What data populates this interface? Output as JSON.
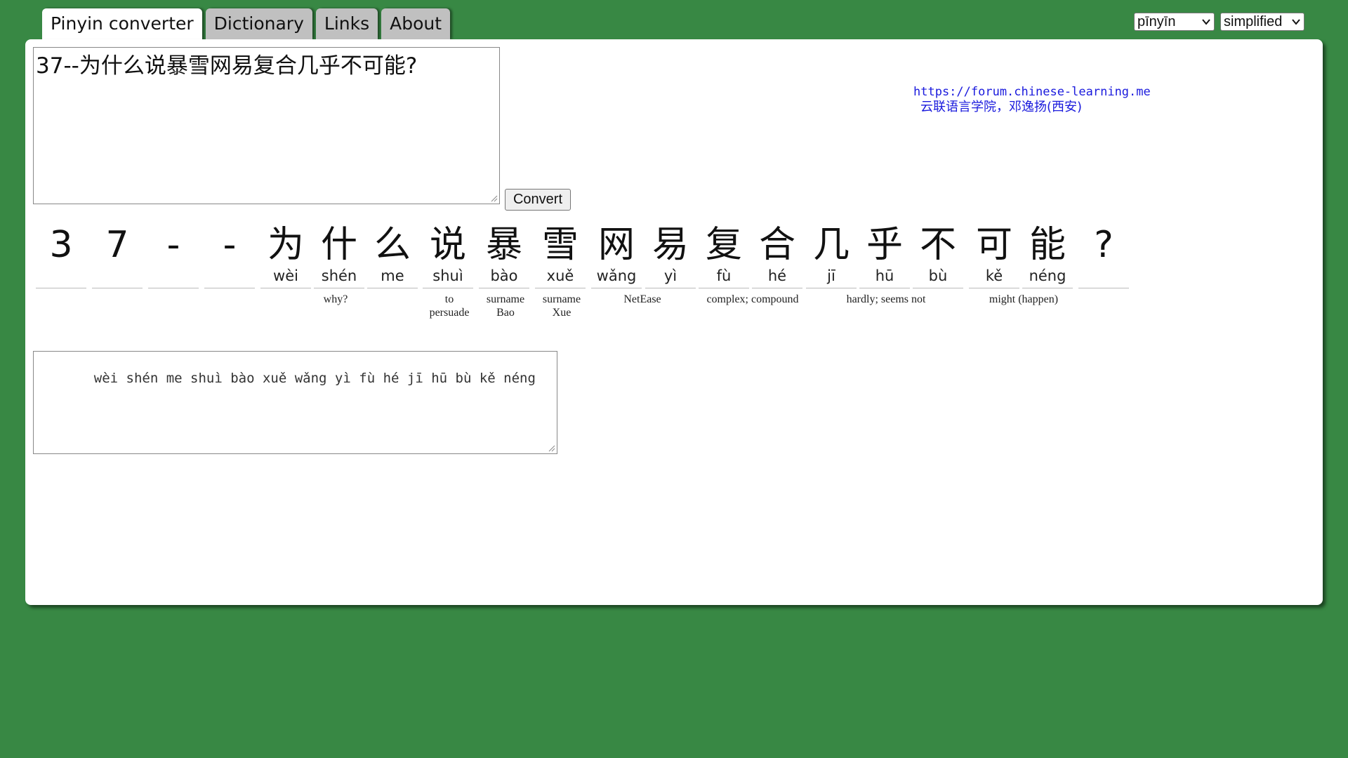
{
  "tabs": [
    {
      "label": "Pinyin converter",
      "active": true
    },
    {
      "label": "Dictionary",
      "active": false
    },
    {
      "label": "Links",
      "active": false
    },
    {
      "label": "About",
      "active": false
    }
  ],
  "selects": {
    "romanization": "pīnyīn",
    "script": "simplified"
  },
  "input_text": "37--为什么说暴雪网易复合几乎不可能?",
  "convert_label": "Convert",
  "credit": {
    "url": "https://forum.chinese-learning.me",
    "org": "云联语言学院，邓逸扬(西安)"
  },
  "characters": [
    {
      "han": "3",
      "py": ""
    },
    {
      "han": "7",
      "py": ""
    },
    {
      "han": "-",
      "py": ""
    },
    {
      "han": "-",
      "py": ""
    },
    {
      "han": "为",
      "py": "wèi"
    },
    {
      "han": "什",
      "py": "shén"
    },
    {
      "han": "么",
      "py": "me"
    },
    {
      "han": "说",
      "py": "shuì"
    },
    {
      "han": "暴",
      "py": "bào"
    },
    {
      "han": "雪",
      "py": "xuě"
    },
    {
      "han": "网",
      "py": "wǎng"
    },
    {
      "han": "易",
      "py": "yì"
    },
    {
      "han": "复",
      "py": "fù"
    },
    {
      "han": "合",
      "py": "hé"
    },
    {
      "han": "几",
      "py": "jī"
    },
    {
      "han": "乎",
      "py": "hū"
    },
    {
      "han": "不",
      "py": "bù"
    },
    {
      "han": "可",
      "py": "kě"
    },
    {
      "han": "能",
      "py": "néng"
    },
    {
      "han": "?",
      "py": ""
    }
  ],
  "glosses": [
    {
      "text": "why?"
    },
    {
      "text": "to persuade"
    },
    {
      "text": "surname Bao"
    },
    {
      "text": "surname Xue"
    },
    {
      "text": "NetEase"
    },
    {
      "text": "complex; compound"
    },
    {
      "text": "hardly; seems not"
    },
    {
      "text": "might (happen)"
    }
  ],
  "output_text": "wèi shén me shuì bào xuě wǎng yì fù hé jī hū bù kě néng"
}
